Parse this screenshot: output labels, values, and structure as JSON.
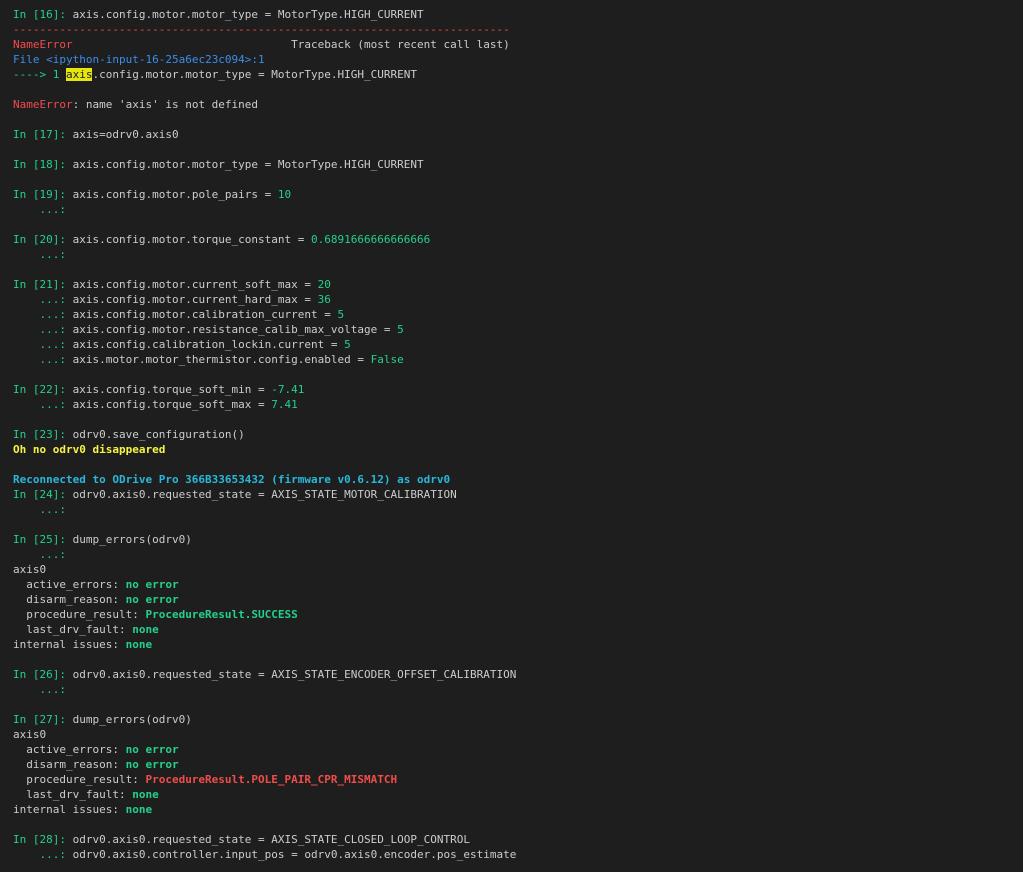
{
  "colors": {
    "background": "#1e1e1e",
    "default_text": "#cccccc",
    "prompt_green": "#23d18b",
    "number_green": "#23d18b",
    "error_red": "#f14c4c",
    "traceback_file_blue": "#3b8eea",
    "warning_yellow": "#f5f543",
    "reconnect_cyan": "#29b8db",
    "highlight_bg": "#e5e510",
    "highlight_fg": "#1e1e1e"
  },
  "lines": [
    {
      "name": "in-16-line",
      "segments": [
        {
          "t": "In [16]: ",
          "c": "prompt_green"
        },
        {
          "t": "axis.config.motor.motor_type = MotorType.HIGH_CURRENT"
        }
      ]
    },
    {
      "name": "traceback-separator",
      "segments": [
        {
          "t": "---------------------------------------------------------------------------",
          "c": "error_red"
        }
      ]
    },
    {
      "name": "traceback-header",
      "segments": [
        {
          "t": "NameError",
          "c": "error_red"
        },
        {
          "t": "                                 Traceback (most recent call last)"
        }
      ]
    },
    {
      "name": "traceback-file",
      "segments": [
        {
          "t": "File ",
          "c": "traceback_file_blue"
        },
        {
          "t": "<ipython-input-16-25a6ec23c094>:1",
          "c": "traceback_file_blue"
        }
      ]
    },
    {
      "name": "traceback-code-line",
      "segments": [
        {
          "t": "----> 1 ",
          "c": "prompt_green"
        },
        {
          "t": "axis",
          "c": "highlight"
        },
        {
          "t": ".config.motor.motor_type = MotorType.HIGH_CURRENT"
        }
      ]
    },
    {
      "name": "blank-line",
      "segments": []
    },
    {
      "name": "name-error-message",
      "segments": [
        {
          "t": "NameError",
          "c": "error_red"
        },
        {
          "t": ": name 'axis' is not defined"
        }
      ]
    },
    {
      "name": "blank-line",
      "segments": []
    },
    {
      "name": "in-17-line",
      "segments": [
        {
          "t": "In [17]: ",
          "c": "prompt_green"
        },
        {
          "t": "axis=odrv0.axis0"
        }
      ]
    },
    {
      "name": "blank-line",
      "segments": []
    },
    {
      "name": "in-18-line",
      "segments": [
        {
          "t": "In [18]: ",
          "c": "prompt_green"
        },
        {
          "t": "axis.config.motor.motor_type = MotorType.HIGH_CURRENT"
        }
      ]
    },
    {
      "name": "blank-line",
      "segments": []
    },
    {
      "name": "in-19-line",
      "segments": [
        {
          "t": "In [19]: ",
          "c": "prompt_green"
        },
        {
          "t": "axis.config.motor.pole_pairs = "
        },
        {
          "t": "10",
          "c": "number_green"
        }
      ]
    },
    {
      "name": "continuation-line",
      "segments": [
        {
          "t": "    ...: ",
          "c": "prompt_green"
        }
      ]
    },
    {
      "name": "blank-line",
      "segments": []
    },
    {
      "name": "in-20-line",
      "segments": [
        {
          "t": "In [20]: ",
          "c": "prompt_green"
        },
        {
          "t": "axis.config.motor.torque_constant = "
        },
        {
          "t": "0.6891666666666666",
          "c": "number_green"
        }
      ]
    },
    {
      "name": "continuation-line",
      "segments": [
        {
          "t": "    ...: ",
          "c": "prompt_green"
        }
      ]
    },
    {
      "name": "blank-line",
      "segments": []
    },
    {
      "name": "in-21-line",
      "segments": [
        {
          "t": "In [21]: ",
          "c": "prompt_green"
        },
        {
          "t": "axis.config.motor.current_soft_max = "
        },
        {
          "t": "20",
          "c": "number_green"
        }
      ]
    },
    {
      "name": "continuation-line",
      "segments": [
        {
          "t": "    ...: ",
          "c": "prompt_green"
        },
        {
          "t": "axis.config.motor.current_hard_max = "
        },
        {
          "t": "36",
          "c": "number_green"
        }
      ]
    },
    {
      "name": "continuation-line",
      "segments": [
        {
          "t": "    ...: ",
          "c": "prompt_green"
        },
        {
          "t": "axis.config.motor.calibration_current = "
        },
        {
          "t": "5",
          "c": "number_green"
        }
      ]
    },
    {
      "name": "continuation-line",
      "segments": [
        {
          "t": "    ...: ",
          "c": "prompt_green"
        },
        {
          "t": "axis.config.motor.resistance_calib_max_voltage = "
        },
        {
          "t": "5",
          "c": "number_green"
        }
      ]
    },
    {
      "name": "continuation-line",
      "segments": [
        {
          "t": "    ...: ",
          "c": "prompt_green"
        },
        {
          "t": "axis.config.calibration_lockin.current = "
        },
        {
          "t": "5",
          "c": "number_green"
        }
      ]
    },
    {
      "name": "continuation-line",
      "segments": [
        {
          "t": "    ...: ",
          "c": "prompt_green"
        },
        {
          "t": "axis.motor.motor_thermistor.config.enabled = "
        },
        {
          "t": "False",
          "c": "number_green"
        }
      ]
    },
    {
      "name": "blank-line",
      "segments": []
    },
    {
      "name": "in-22-line",
      "segments": [
        {
          "t": "In [22]: ",
          "c": "prompt_green"
        },
        {
          "t": "axis.config.torque_soft_min = "
        },
        {
          "t": "-7.41",
          "c": "number_green"
        }
      ]
    },
    {
      "name": "continuation-line",
      "segments": [
        {
          "t": "    ...: ",
          "c": "prompt_green"
        },
        {
          "t": "axis.config.torque_soft_max = "
        },
        {
          "t": "7.41",
          "c": "number_green"
        }
      ]
    },
    {
      "name": "blank-line",
      "segments": []
    },
    {
      "name": "in-23-line",
      "segments": [
        {
          "t": "In [23]: ",
          "c": "prompt_green"
        },
        {
          "t": "odrv0.save_configuration()"
        }
      ]
    },
    {
      "name": "disappeared-message",
      "segments": [
        {
          "t": "Oh no odrv0 disappeared",
          "c": "warning_yellow",
          "b": true
        }
      ]
    },
    {
      "name": "blank-line",
      "segments": []
    },
    {
      "name": "reconnected-message",
      "segments": [
        {
          "t": "Reconnected to ODrive Pro 366B33653432 (firmware v0.6.12) as odrv0",
          "c": "reconnect_cyan",
          "b": true
        }
      ]
    },
    {
      "name": "in-24-line",
      "segments": [
        {
          "t": "In [24]: ",
          "c": "prompt_green"
        },
        {
          "t": "odrv0.axis0.requested_state = AXIS_STATE_MOTOR_CALIBRATION"
        }
      ]
    },
    {
      "name": "continuation-line",
      "segments": [
        {
          "t": "    ...: ",
          "c": "prompt_green"
        }
      ]
    },
    {
      "name": "blank-line",
      "segments": []
    },
    {
      "name": "in-25-line",
      "segments": [
        {
          "t": "In [25]: ",
          "c": "prompt_green"
        },
        {
          "t": "dump_errors(odrv0)"
        }
      ]
    },
    {
      "name": "continuation-line",
      "segments": [
        {
          "t": "    ...: ",
          "c": "prompt_green"
        }
      ]
    },
    {
      "name": "axis0-header",
      "segments": [
        {
          "t": "axis0"
        }
      ]
    },
    {
      "name": "active-errors-line",
      "segments": [
        {
          "t": "  active_errors: "
        },
        {
          "t": "no error",
          "c": "prompt_green",
          "b": true
        }
      ]
    },
    {
      "name": "disarm-reason-line",
      "segments": [
        {
          "t": "  disarm_reason: "
        },
        {
          "t": "no error",
          "c": "prompt_green",
          "b": true
        }
      ]
    },
    {
      "name": "procedure-result-line",
      "segments": [
        {
          "t": "  procedure_result: "
        },
        {
          "t": "ProcedureResult.SUCCESS",
          "c": "prompt_green",
          "b": true
        }
      ]
    },
    {
      "name": "last-drv-fault-line",
      "segments": [
        {
          "t": "  last_drv_fault: "
        },
        {
          "t": "none",
          "c": "prompt_green",
          "b": true
        }
      ]
    },
    {
      "name": "internal-issues-line",
      "segments": [
        {
          "t": "internal issues: "
        },
        {
          "t": "none",
          "c": "prompt_green",
          "b": true
        }
      ]
    },
    {
      "name": "blank-line",
      "segments": []
    },
    {
      "name": "in-26-line",
      "segments": [
        {
          "t": "In [26]: ",
          "c": "prompt_green"
        },
        {
          "t": "odrv0.axis0.requested_state = AXIS_STATE_ENCODER_OFFSET_CALIBRATION"
        }
      ]
    },
    {
      "name": "continuation-line",
      "segments": [
        {
          "t": "    ...: ",
          "c": "prompt_green"
        }
      ]
    },
    {
      "name": "blank-line",
      "segments": []
    },
    {
      "name": "in-27-line",
      "segments": [
        {
          "t": "In [27]: ",
          "c": "prompt_green"
        },
        {
          "t": "dump_errors(odrv0)"
        }
      ]
    },
    {
      "name": "axis0-header",
      "segments": [
        {
          "t": "axis0"
        }
      ]
    },
    {
      "name": "active-errors-line",
      "segments": [
        {
          "t": "  active_errors: "
        },
        {
          "t": "no error",
          "c": "prompt_green",
          "b": true
        }
      ]
    },
    {
      "name": "disarm-reason-line",
      "segments": [
        {
          "t": "  disarm_reason: "
        },
        {
          "t": "no error",
          "c": "prompt_green",
          "b": true
        }
      ]
    },
    {
      "name": "procedure-result-line",
      "segments": [
        {
          "t": "  procedure_result: "
        },
        {
          "t": "ProcedureResult.POLE_PAIR_CPR_MISMATCH",
          "c": "error_red",
          "b": true
        }
      ]
    },
    {
      "name": "last-drv-fault-line",
      "segments": [
        {
          "t": "  last_drv_fault: "
        },
        {
          "t": "none",
          "c": "prompt_green",
          "b": true
        }
      ]
    },
    {
      "name": "internal-issues-line",
      "segments": [
        {
          "t": "internal issues: "
        },
        {
          "t": "none",
          "c": "prompt_green",
          "b": true
        }
      ]
    },
    {
      "name": "blank-line",
      "segments": []
    },
    {
      "name": "in-28-line",
      "segments": [
        {
          "t": "In [28]: ",
          "c": "prompt_green"
        },
        {
          "t": "odrv0.axis0.requested_state = AXIS_STATE_CLOSED_LOOP_CONTROL"
        }
      ]
    },
    {
      "name": "continuation-line",
      "segments": [
        {
          "t": "    ...: ",
          "c": "prompt_green"
        },
        {
          "t": "odrv0.axis0.controller.input_pos = odrv0.axis0.encoder.pos_estimate"
        }
      ]
    }
  ]
}
